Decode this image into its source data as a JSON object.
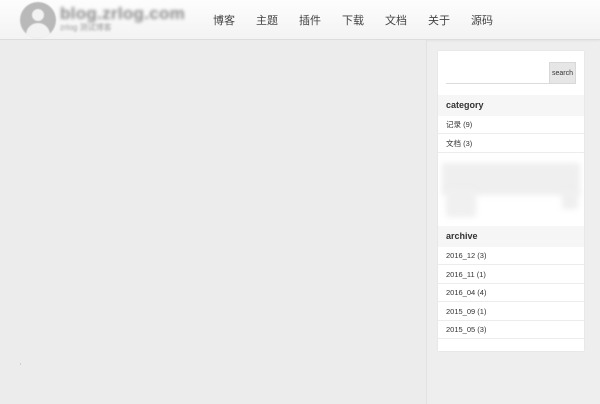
{
  "header": {
    "site_title": "blog.zrlog.com",
    "site_subtitle": "zrlog 测试博客"
  },
  "nav": [
    {
      "label": "博客"
    },
    {
      "label": "主题"
    },
    {
      "label": "插件"
    },
    {
      "label": "下载"
    },
    {
      "label": "文档"
    },
    {
      "label": "关于"
    },
    {
      "label": "源码"
    }
  ],
  "sidebar": {
    "search": {
      "placeholder": "",
      "button_label": "search"
    },
    "category": {
      "title": "category",
      "items": [
        {
          "label": "记录 (9)"
        },
        {
          "label": "文档 (3)"
        }
      ]
    },
    "archive": {
      "title": "archive",
      "items": [
        {
          "label": "2016_12 (3)"
        },
        {
          "label": "2016_11 (1)"
        },
        {
          "label": "2016_04 (4)"
        },
        {
          "label": "2015_09 (1)"
        },
        {
          "label": "2015_05 (3)"
        }
      ]
    }
  }
}
